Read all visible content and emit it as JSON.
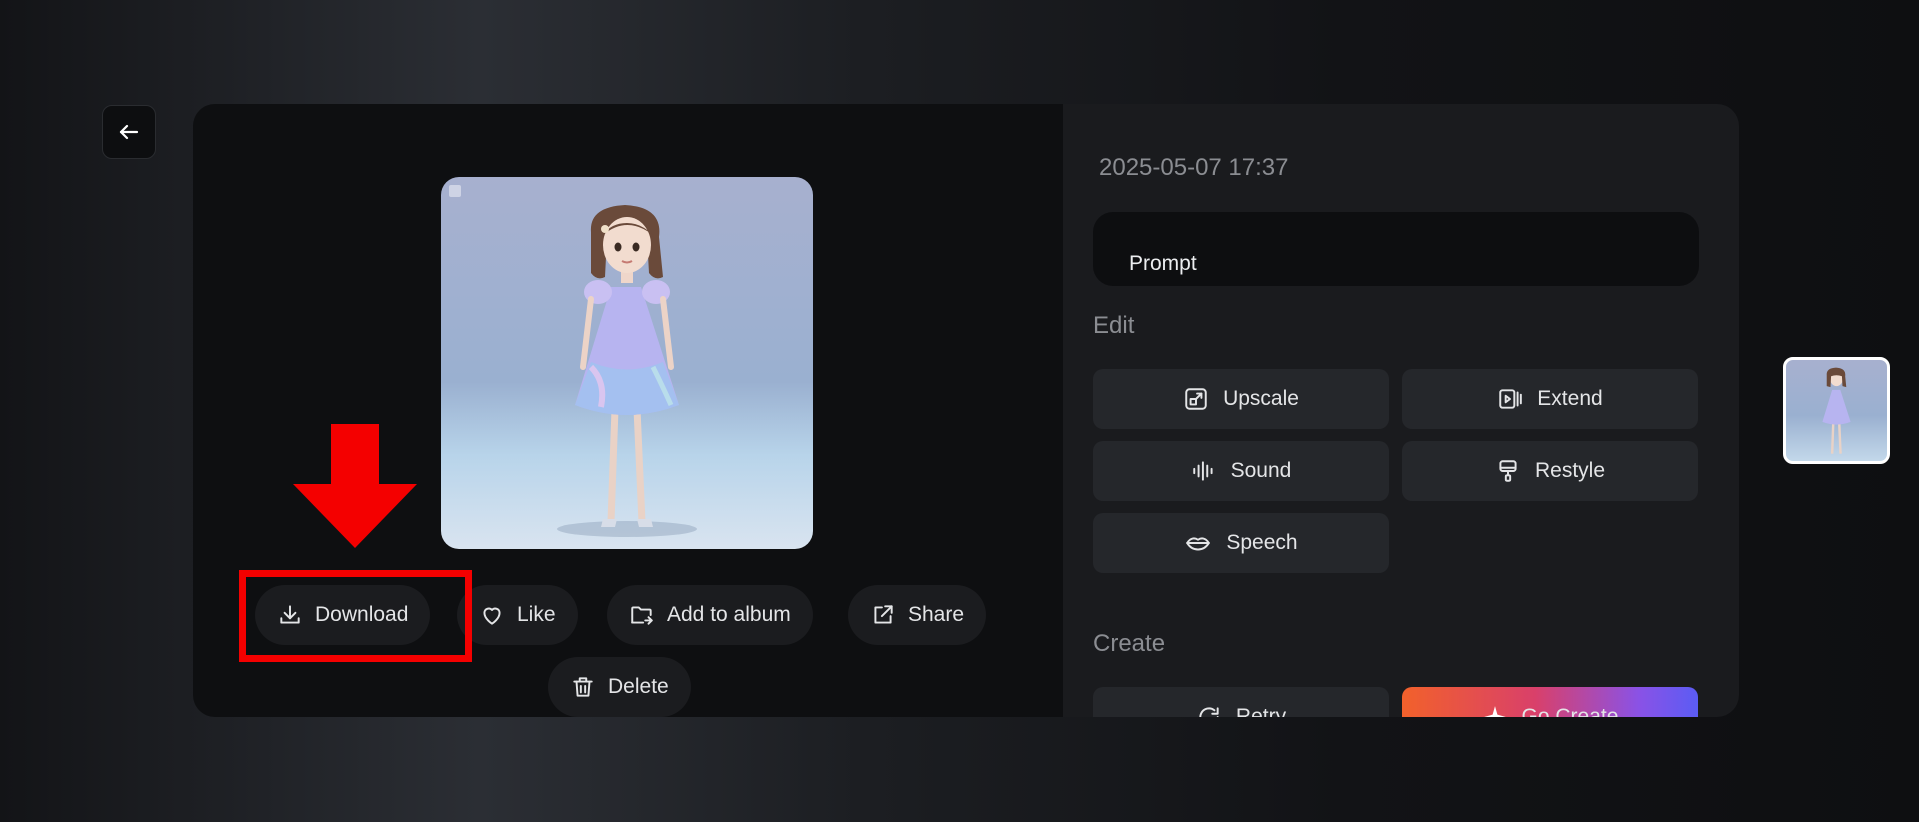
{
  "timestamp": "2025-05-07 17:37",
  "prompt_label": "Prompt",
  "sections": {
    "edit": "Edit",
    "create": "Create"
  },
  "actions": {
    "download": "Download",
    "like": "Like",
    "add_to_album": "Add to album",
    "share": "Share",
    "delete": "Delete"
  },
  "tools": {
    "upscale": "Upscale",
    "extend": "Extend",
    "sound": "Sound",
    "restyle": "Restyle",
    "speech": "Speech",
    "retry": "Retry",
    "go_create": "Go Create"
  },
  "icons": {
    "back": "arrow-left-icon",
    "download": "download-icon",
    "like": "heart-icon",
    "album": "folder-add-icon",
    "share": "external-link-icon",
    "delete": "trash-icon",
    "upscale": "upscale-icon",
    "extend": "extend-icon",
    "sound": "waveform-icon",
    "restyle": "brush-icon",
    "speech": "lips-icon",
    "retry": "refresh-icon",
    "go_create": "sparkle-icon"
  },
  "colors": {
    "highlight": "#f40000",
    "accent_gradient_start": "#f2612b",
    "accent_gradient_end": "#5b5cf4"
  }
}
